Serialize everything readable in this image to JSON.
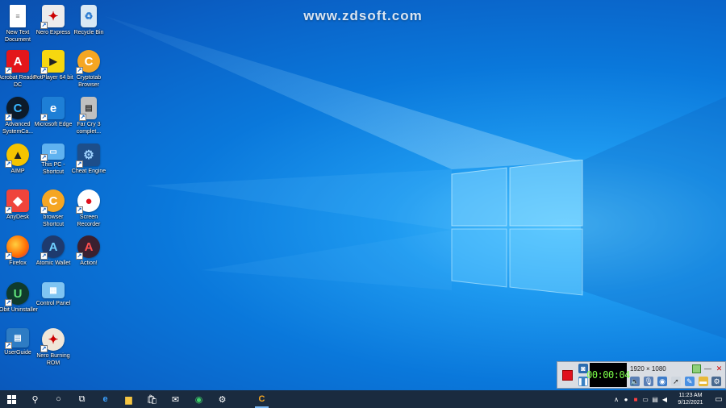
{
  "watermark": "www.zdsoft.com",
  "desktop_icons": [
    {
      "label": "New Text Document",
      "icon": "text-document-icon",
      "color": "#ffffff"
    },
    {
      "label": "Nero Express",
      "icon": "nero-express-icon",
      "color": "#e8e8e8"
    },
    {
      "label": "Recycle Bin",
      "icon": "recycle-bin-icon",
      "color": "#d8e8f4"
    },
    {
      "label": "Acrobat Reader DC",
      "icon": "acrobat-icon",
      "color": "#e3161b"
    },
    {
      "label": "PotPlayer 64 bit",
      "icon": "potplayer-icon",
      "color": "#f6d70f"
    },
    {
      "label": "Cryptotab Browser",
      "icon": "cryptotab-icon",
      "color": "#f5a623"
    },
    {
      "label": "Advanced SystemCa...",
      "icon": "advanced-systemcare-icon",
      "color": "#0d1b2a"
    },
    {
      "label": "Microsoft Edge",
      "icon": "edge-icon",
      "color": "#1e7fd6"
    },
    {
      "label": "Far Cry 3 complet...",
      "icon": "far-cry-icon",
      "color": "#c0c0c0"
    },
    {
      "label": "AIMP",
      "icon": "aimp-icon",
      "color": "#f5c400"
    },
    {
      "label": "This PC - Shortcut",
      "icon": "this-pc-icon",
      "color": "#5fb2f0"
    },
    {
      "label": "Cheat Engine",
      "icon": "cheat-engine-icon",
      "color": "#1d4e8a"
    },
    {
      "label": "AnyDesk",
      "icon": "anydesk-icon",
      "color": "#ef443b"
    },
    {
      "label": "browser Shortcut",
      "icon": "browser-shortcut-icon",
      "color": "#f5a623"
    },
    {
      "label": "Screen Recorder",
      "icon": "screen-recorder-icon",
      "color": "#ffffff"
    },
    {
      "label": "Firefox",
      "icon": "firefox-icon",
      "color": "#ff7a00"
    },
    {
      "label": "Atomic Wallet",
      "icon": "atomic-wallet-icon",
      "color": "#1e3a6e"
    },
    {
      "label": "Action!",
      "icon": "action-icon",
      "color": "#3a2030"
    },
    {
      "label": "IObit Uninstaller",
      "icon": "iobit-uninstaller-icon",
      "color": "#0f3b2c"
    },
    {
      "label": "Control Panel",
      "icon": "control-panel-icon",
      "color": "#7fc4f2"
    },
    {
      "label": "UserGuide",
      "icon": "user-guide-icon",
      "color": "#2e7cc4"
    },
    {
      "label": "Nero Burning ROM",
      "icon": "nero-burning-rom-icon",
      "color": "#f0e6d8"
    }
  ],
  "recorder": {
    "timer": "00:00:04",
    "resolution": "1920 × 1080",
    "record_color": "#e0101c"
  },
  "taskbar": {
    "clock_time": "11:23 AM",
    "clock_date": "9/12/2021"
  }
}
